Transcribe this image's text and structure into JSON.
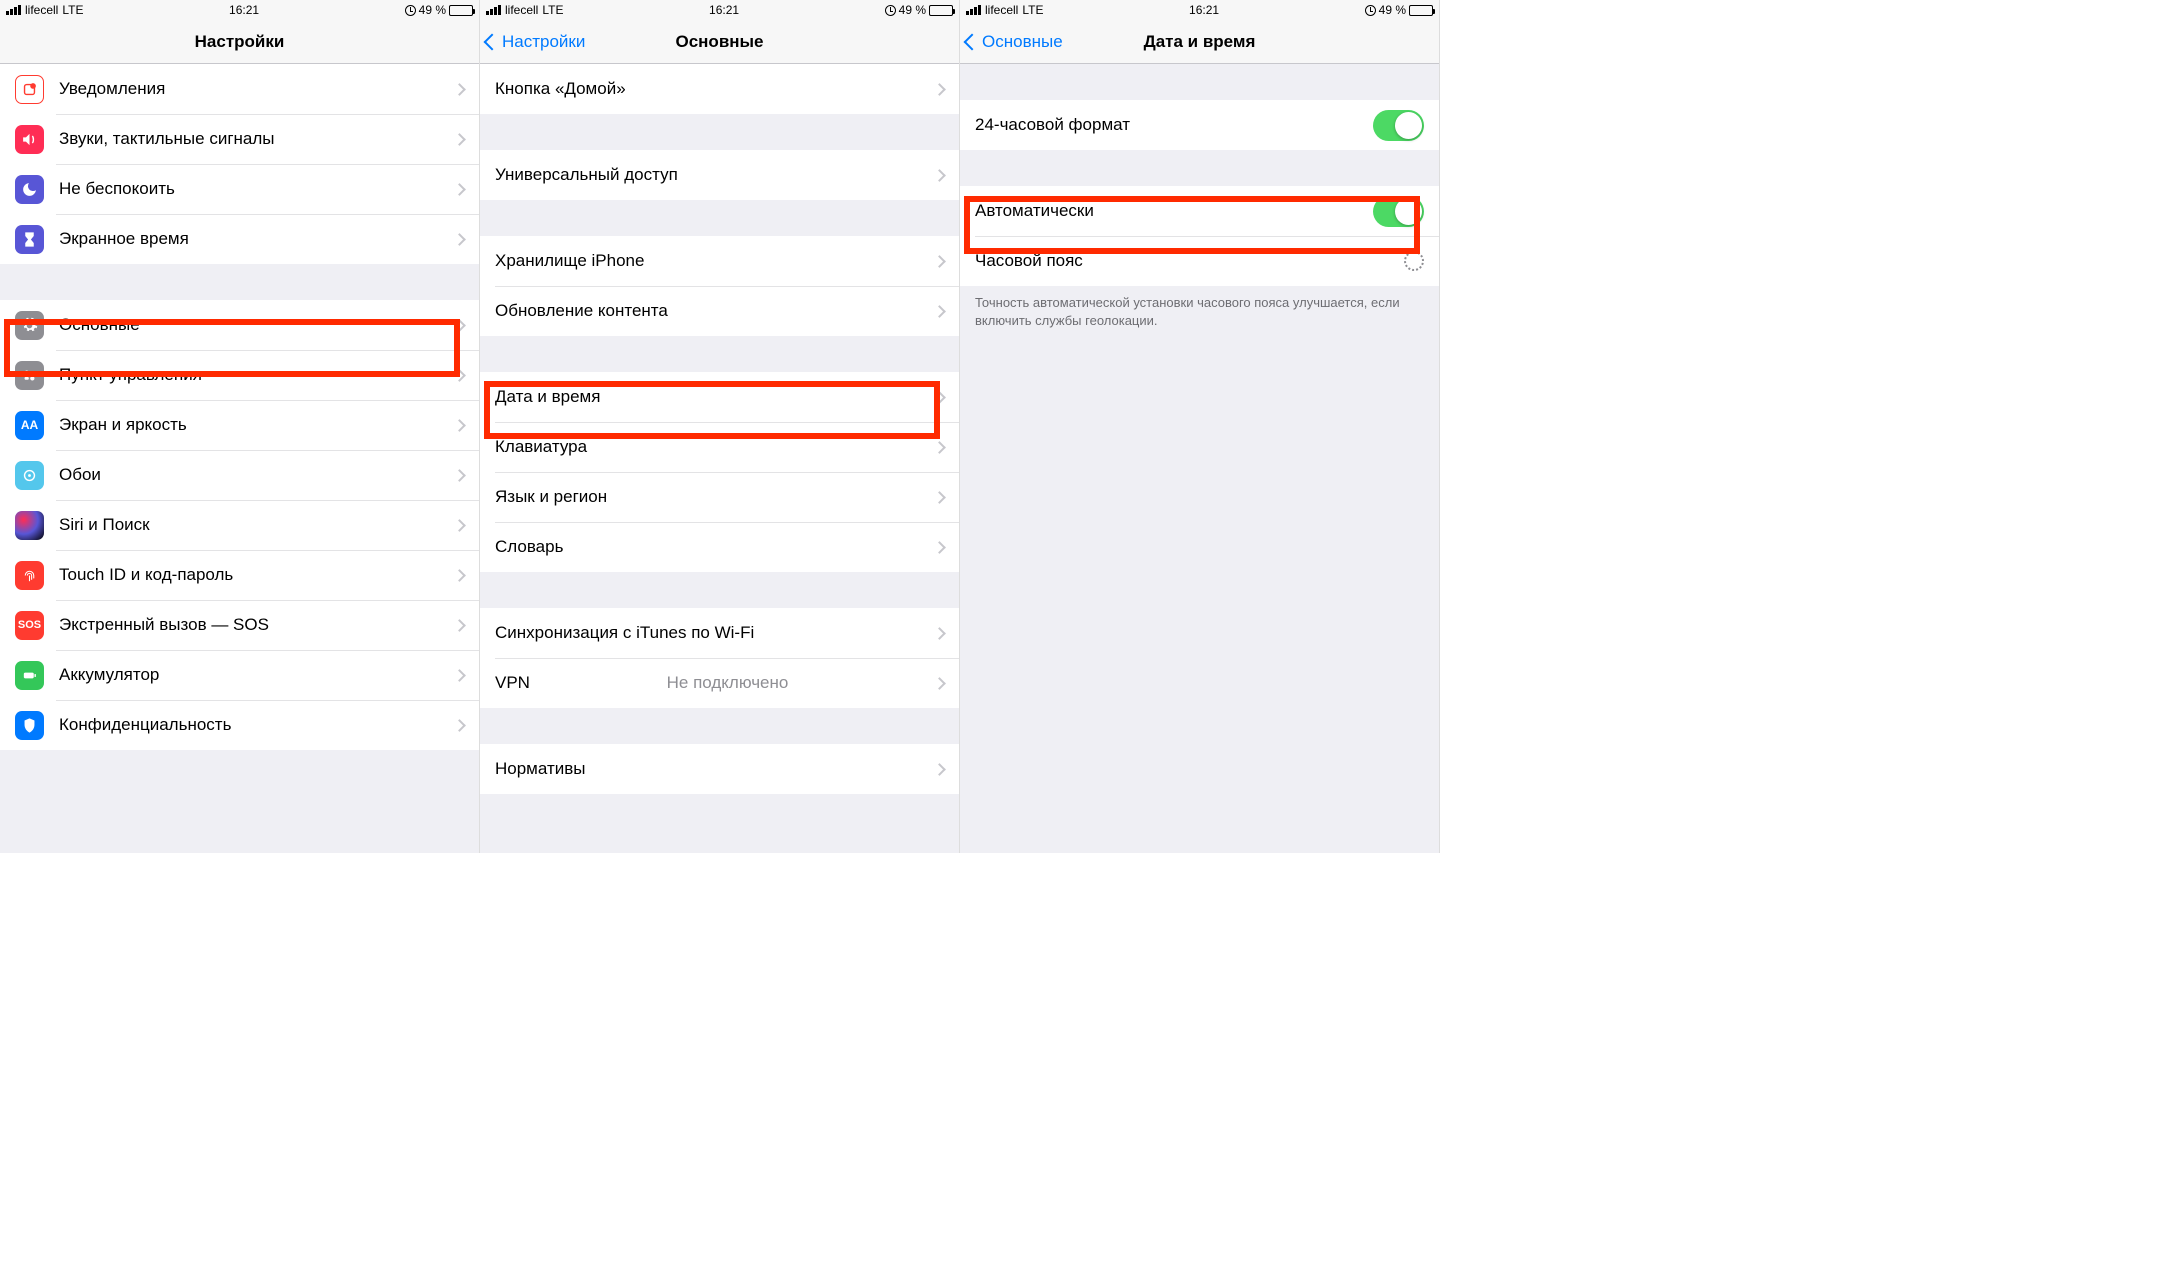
{
  "status": {
    "carrier": "lifecell",
    "network": "LTE",
    "time": "16:21",
    "battery_pct": "49 %"
  },
  "screen1": {
    "title": "Настройки",
    "rows": {
      "notifications": "Уведомления",
      "sounds": "Звуки, тактильные сигналы",
      "dnd": "Не беспокоить",
      "screentime": "Экранное время",
      "general": "Основные",
      "control_center": "Пункт управления",
      "display": "Экран и яркость",
      "wallpaper": "Обои",
      "siri": "Siri и Поиск",
      "touchid": "Touch ID и код-пароль",
      "sos": "Экстренный вызов — SOS",
      "battery": "Аккумулятор",
      "privacy": "Конфиденциальность"
    }
  },
  "screen2": {
    "back": "Настройки",
    "title": "Основные",
    "rows": {
      "home_button": "Кнопка «Домой»",
      "accessibility": "Универсальный доступ",
      "storage": "Хранилище iPhone",
      "background_refresh": "Обновление контента",
      "date_time": "Дата и время",
      "keyboard": "Клавиатура",
      "language": "Язык и регион",
      "dictionary": "Словарь",
      "itunes_wifi": "Синхронизация с iTunes по Wi-Fi",
      "vpn": "VPN",
      "vpn_value": "Не подключено",
      "regulatory": "Нормативы"
    }
  },
  "screen3": {
    "back": "Основные",
    "title": "Дата и время",
    "rows": {
      "format24": "24-часовой формат",
      "auto": "Автоматически",
      "timezone": "Часовой пояс"
    },
    "note": "Точность автоматической установки часового пояса улучшается, если включить службы геолокации."
  },
  "colors": {
    "notifications": "#ff3b30",
    "sounds": "#ff2d55",
    "dnd": "#5856d6",
    "screentime": "#5856d6",
    "general": "#8e8e93",
    "control_center": "#8e8e93",
    "display": "#007aff",
    "wallpaper": "#54c7ec",
    "siri": "#1c1c1e",
    "touchid": "#ff3b30",
    "sos": "#ff3b30",
    "battery": "#34c759",
    "privacy": "#007aff"
  }
}
